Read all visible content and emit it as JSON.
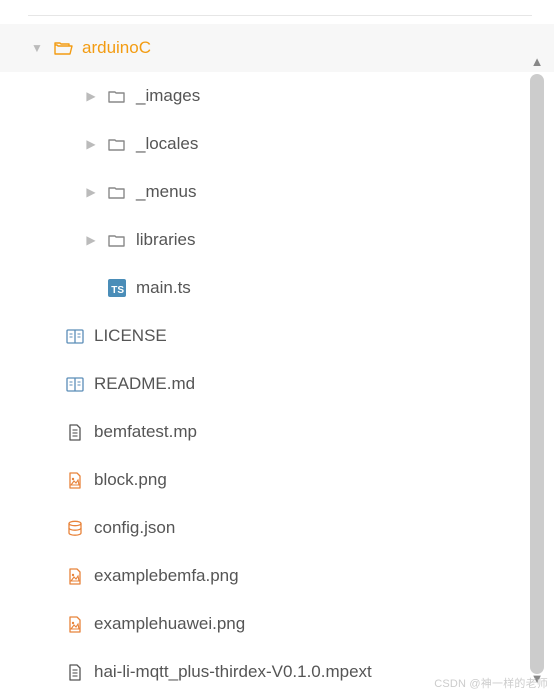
{
  "tree": {
    "root": {
      "label": "arduinoC",
      "icon": "folder-open-icon",
      "expanded": true
    },
    "children": [
      {
        "label": "_images",
        "icon": "folder-icon",
        "expandable": true
      },
      {
        "label": "_locales",
        "icon": "folder-icon",
        "expandable": true
      },
      {
        "label": "_menus",
        "icon": "folder-icon",
        "expandable": true
      },
      {
        "label": "libraries",
        "icon": "folder-icon",
        "expandable": true
      },
      {
        "label": "main.ts",
        "icon": "ts-file-icon",
        "expandable": false
      }
    ],
    "files": [
      {
        "label": "LICENSE",
        "icon": "book-icon"
      },
      {
        "label": "README.md",
        "icon": "book-icon"
      },
      {
        "label": "bemfatest.mp",
        "icon": "doc-icon"
      },
      {
        "label": "block.png",
        "icon": "image-icon"
      },
      {
        "label": "config.json",
        "icon": "db-icon"
      },
      {
        "label": "examplebemfa.png",
        "icon": "image-icon"
      },
      {
        "label": "examplehuawei.png",
        "icon": "image-icon"
      },
      {
        "label": "hai-li-mqtt_plus-thirdex-V0.1.0.mpext",
        "icon": "doc-icon"
      }
    ]
  },
  "icons": {
    "ts-file-icon": "TS"
  },
  "watermark": "CSDN @神一样的老师"
}
